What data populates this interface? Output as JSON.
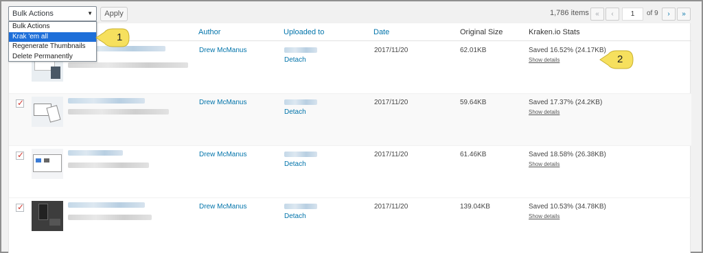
{
  "toolbar": {
    "bulk_select_value": "Bulk Actions",
    "apply_label": "Apply"
  },
  "dropdown": {
    "items": [
      "Bulk Actions",
      "Krak 'em all",
      "Regenerate Thumbnails",
      "Delete Permanently"
    ],
    "highlighted_index": 1
  },
  "pagination": {
    "displaying": "1,786 items",
    "first": "«",
    "prev": "‹",
    "current_page": "1",
    "of_pages": "of 9",
    "next": "›",
    "last": "»"
  },
  "columns": {
    "author": "Author",
    "uploaded_to": "Uploaded to",
    "date": "Date",
    "original_size": "Original Size",
    "kraken_stats": "Kraken.io Stats"
  },
  "rows": [
    {
      "checked": false,
      "author": "Drew McManus",
      "detach": "Detach",
      "date": "2017/11/20",
      "size": "62.01KB",
      "stats": "Saved 16.52% (24.17KB)",
      "show_details": "Show details"
    },
    {
      "checked": true,
      "author": "Drew McManus",
      "detach": "Detach",
      "date": "2017/11/20",
      "size": "59.64KB",
      "stats": "Saved 17.37% (24.2KB)",
      "show_details": "Show details"
    },
    {
      "checked": true,
      "author": "Drew McManus",
      "detach": "Detach",
      "date": "2017/11/20",
      "size": "61.46KB",
      "stats": "Saved 18.58% (26.38KB)",
      "show_details": "Show details"
    },
    {
      "checked": true,
      "author": "Drew McManus",
      "detach": "Detach",
      "date": "2017/11/20",
      "size": "139.04KB",
      "stats": "Saved 10.53% (34.78KB)",
      "show_details": "Show details"
    }
  ],
  "callouts": [
    "1",
    "2"
  ],
  "colors": {
    "link": "#0073aa",
    "highlight": "#1e6fd9",
    "callout_fill": "#f6e05e",
    "checkmark": "#d0342c"
  }
}
